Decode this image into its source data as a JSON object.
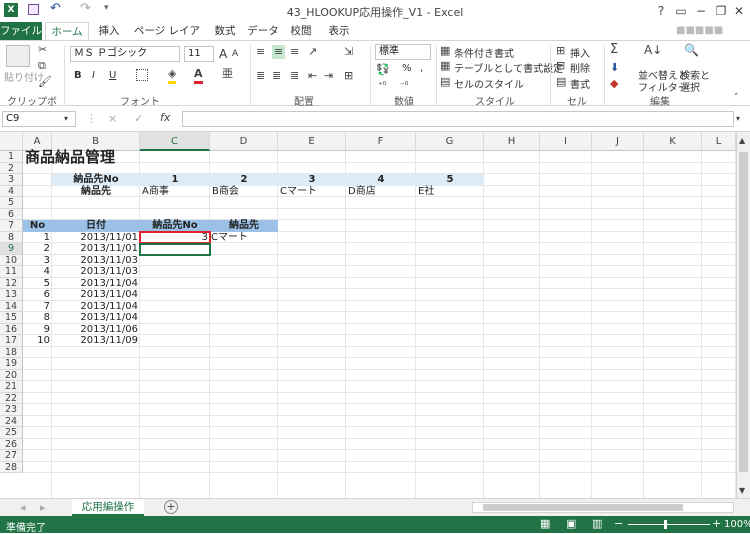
{
  "window": {
    "title": "43_HLOOKUP応用操作_V1 - Excel",
    "help": "?",
    "user": "■■■■■"
  },
  "tabs": [
    "ファイル",
    "ホーム",
    "挿入",
    "ページ レイアウト",
    "数式",
    "データ",
    "校閲",
    "表示"
  ],
  "ribbon": {
    "clipboard": {
      "paste": "貼り付け",
      "label": "クリップボード"
    },
    "font": {
      "name": "ＭＳ Ｐゴシック",
      "size": "11",
      "label": "フォント",
      "bold": "B",
      "italic": "I",
      "underline": "U",
      "grow": "A",
      "shrink": "A"
    },
    "alignment": {
      "label": "配置"
    },
    "number": {
      "format": "標準",
      "percent": "%",
      "comma": ",",
      "label": "数値"
    },
    "styles": {
      "conditional": "条件付き書式",
      "table": "テーブルとして書式設定",
      "cell": "セルのスタイル",
      "label": "スタイル"
    },
    "cells": {
      "insert": "挿入",
      "delete": "削除",
      "format": "書式",
      "label": "セル"
    },
    "editing": {
      "sort": "並べ替えと",
      "sort2": "フィルター",
      "find": "検索と",
      "find2": "選択",
      "label": "編集"
    }
  },
  "formula": {
    "namebox": "C9",
    "fx": "fx",
    "cancel": "×",
    "enter": "✓",
    "value": ""
  },
  "columns": [
    "A",
    "B",
    "C",
    "D",
    "E",
    "F",
    "G",
    "H",
    "I",
    "J",
    "K",
    "L"
  ],
  "rows": [
    "1",
    "2",
    "3",
    "4",
    "5",
    "6",
    "7",
    "8",
    "9",
    "10",
    "11",
    "12",
    "13",
    "14",
    "15",
    "16",
    "17",
    "18",
    "19",
    "20",
    "21",
    "22",
    "23",
    "24",
    "25",
    "26",
    "27",
    "28"
  ],
  "sheet": {
    "title": "商品納品管理",
    "supplier_header_label": "納品先No",
    "supplier_numbers": [
      "1",
      "2",
      "3",
      "4",
      "5"
    ],
    "supplier_name_label": "納品先",
    "supplier_names": [
      "A商事",
      "B商会",
      "Cマート",
      "D商店",
      "E社"
    ],
    "table_headers": [
      "No",
      "日付",
      "納品先No",
      "納品先"
    ],
    "records": [
      {
        "no": "1",
        "date": "2013/11/01",
        "supplier_no": "3",
        "supplier": "Cマート"
      },
      {
        "no": "2",
        "date": "2013/11/01",
        "supplier_no": "",
        "supplier": ""
      },
      {
        "no": "3",
        "date": "2013/11/03",
        "supplier_no": "",
        "supplier": ""
      },
      {
        "no": "4",
        "date": "2013/11/03",
        "supplier_no": "",
        "supplier": ""
      },
      {
        "no": "5",
        "date": "2013/11/04",
        "supplier_no": "",
        "supplier": ""
      },
      {
        "no": "6",
        "date": "2013/11/04",
        "supplier_no": "",
        "supplier": ""
      },
      {
        "no": "7",
        "date": "2013/11/04",
        "supplier_no": "",
        "supplier": ""
      },
      {
        "no": "8",
        "date": "2013/11/04",
        "supplier_no": "",
        "supplier": ""
      },
      {
        "no": "9",
        "date": "2013/11/06",
        "supplier_no": "",
        "supplier": ""
      },
      {
        "no": "10",
        "date": "2013/11/09",
        "supplier_no": "",
        "supplier": ""
      }
    ]
  },
  "sheettab": {
    "name": "応用編操作",
    "add": "+"
  },
  "status": {
    "ready": "準備完了",
    "zoom": "100%"
  },
  "colors": {
    "excel_green": "#217346",
    "light_blue_band": "#ddebf7",
    "header_blue": "#9bc2e6",
    "highlight_red": "#e0202a"
  }
}
